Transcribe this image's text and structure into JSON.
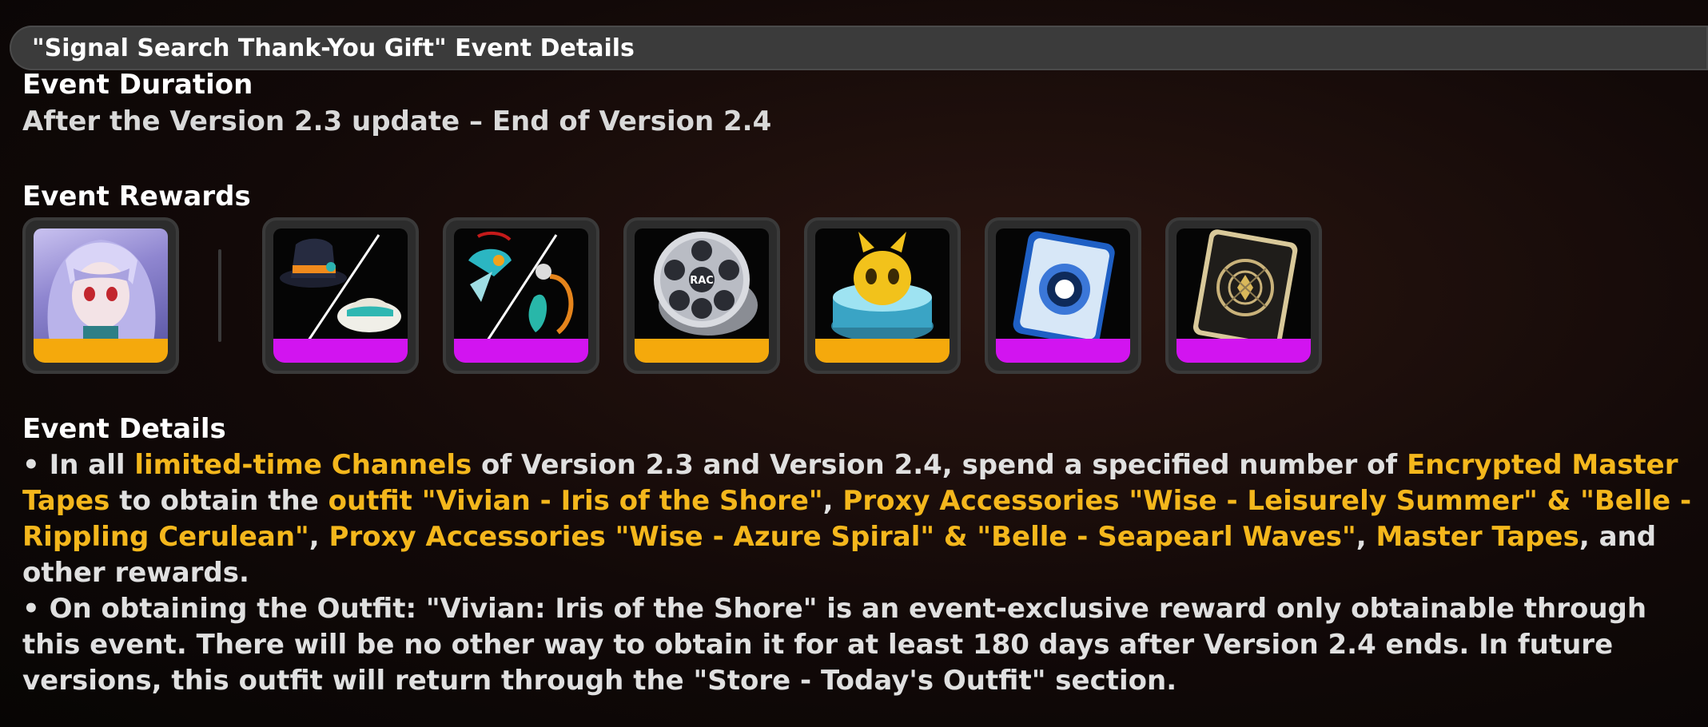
{
  "header": {
    "title": "\"Signal Search Thank-You Gift\" Event Details"
  },
  "duration": {
    "heading": "Event Duration",
    "text": "After the Version 2.3 update – End of Version 2.4"
  },
  "rewards": {
    "heading": "Event Rewards",
    "items": [
      {
        "name": "Vivian outfit",
        "icon": "vivian-portrait",
        "rarity_color": "#f5a90c"
      },
      {
        "name": "Wise hat / Belle hat",
        "icon": "hats",
        "rarity_color": "#d214f0"
      },
      {
        "name": "Wise / Belle accessories",
        "icon": "accessories",
        "rarity_color": "#d214f0"
      },
      {
        "name": "Master Tape reel",
        "icon": "film-reel",
        "rarity_color": "#f5a90c"
      },
      {
        "name": "Bangboo token",
        "icon": "bangboo",
        "rarity_color": "#f5a90c"
      },
      {
        "name": "Blue card",
        "icon": "blue-card",
        "rarity_color": "#d214f0"
      },
      {
        "name": "Black gold card",
        "icon": "black-card",
        "rarity_color": "#d214f0"
      }
    ]
  },
  "details": {
    "heading": "Event Details",
    "p1": {
      "t1": "• In all ",
      "h1": "limited-time Channels",
      "t2": " of Version 2.3 and Version 2.4, spend a specified number of ",
      "h2": "Encrypted Master Tapes",
      "t3": " to obtain the ",
      "h3": "outfit \"Vivian - Iris of the Shore\"",
      "t4": ", ",
      "h4": "Proxy Accessories \"Wise - Leisurely Summer\" & \"Belle - Rippling Cerulean\"",
      "t5": ", ",
      "h5": "Proxy Accessories \"Wise - Azure Spiral\" & \"Belle - Seapearl Waves\"",
      "t6": ", ",
      "h6": "Master Tapes",
      "t7": ", and other rewards."
    },
    "p2": "• On obtaining the Outfit: \"Vivian: Iris of the Shore\" is an event-exclusive reward only obtainable through this event. There will be no other way to obtain it for at least 180 days after Version 2.4 ends. In future versions, this outfit will return through the \"Store - Today's Outfit\" section."
  },
  "colors": {
    "highlight": "#f4b71c",
    "gold": "#f5a90c",
    "purple": "#d214f0"
  }
}
